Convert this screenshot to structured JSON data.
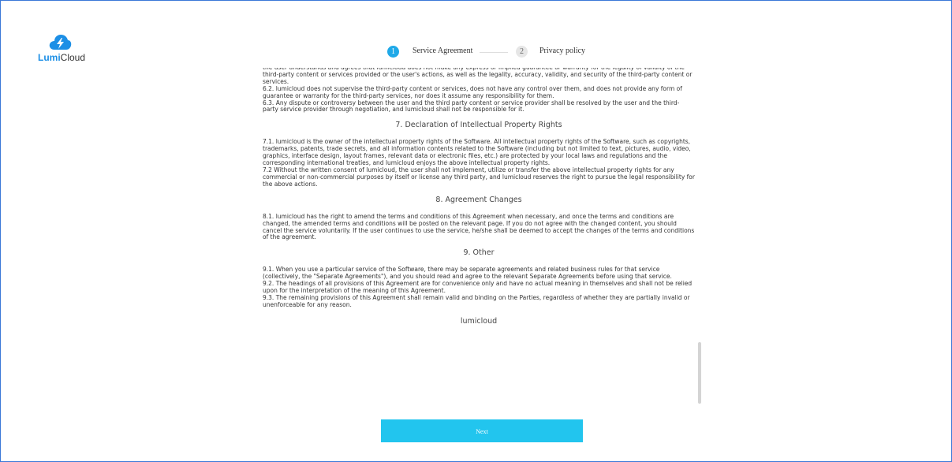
{
  "brand": {
    "name_part1": "Lumi",
    "name_part2": "Cloud",
    "accent": "#1fa9e8",
    "button_color": "#22c5ee",
    "logo_icon": "cloud-lightning-icon"
  },
  "stepper": {
    "steps": [
      {
        "number": "1",
        "label": "Service Agreement",
        "active": true
      },
      {
        "number": "2",
        "label": "Privacy policy",
        "active": false
      }
    ]
  },
  "agreement": {
    "top_paragraph": "the user understands and agrees that lumicloud does not make any express or implied guarantee or warranty for the legality of validity of the third-party content or services provided or the user's actions, as well as the legality, accuracy, validity, and security of the third-party content or services.\n6.2. lumicloud does not supervise the third-party content or services, does not have any control over them, and does not provide any form of guarantee or warranty for the third-party services, nor does it assume any responsibility for them.\n6.3. Any dispute or controversy between the user and the third party content or service provider shall be resolved by the user and the third-party service provider through negotiation, and lumicloud shall not be responsible for it.",
    "sections": [
      {
        "title": "7. Declaration of Intellectual Property Rights",
        "body": "7.1. lumicloud is the owner of the intellectual property rights of the Software. All intellectual property rights of the Software, such as copyrights, trademarks, patents, trade secrets, and all information contents related to the Software (including but not limited to text, pictures, audio, video, graphics, interface design, layout frames, relevant data or electronic files, etc.) are protected by your local laws and regulations and the corresponding international treaties, and lumicloud enjoys the above intellectual property rights.\n7.2 Without the written consent of lumicloud, the user shall not implement, utilize or transfer the above intellectual property rights for any commercial or non-commercial purposes by itself or license any third party, and lumicloud reserves the right to pursue the legal responsibility for the above actions."
      },
      {
        "title": "8. Agreement Changes",
        "body": "8.1. lumicloud has the right to amend the terms and conditions of this Agreement when necessary, and once the terms and conditions are changed, the amended terms and conditions will be posted on the relevant page. If you do not agree with the changed content, you should cancel the service voluntarily. If the user continues to use the service, he/she shall be deemed to accept the changes of the terms and conditions of the agreement."
      },
      {
        "title": "9. Other",
        "body": "9.1. When you use a particular service of the Software, there may be separate agreements and related business rules for that service (collectively, the \"Separate Agreements\"), and you should read and agree to the relevant Separate Agreements before using that service.\n9.2. The headings of all provisions of this Agreement are for convenience only and have no actual meaning in themselves and shall not be relied upon for the interpretation of the meaning of this Agreement.\n9.3. The remaining provisions of this Agreement shall remain valid and binding on the Parties, regardless of whether they are partially invalid or unenforceable for any reason."
      }
    ],
    "signature": "lumicloud"
  },
  "actions": {
    "next_label": "Next"
  }
}
